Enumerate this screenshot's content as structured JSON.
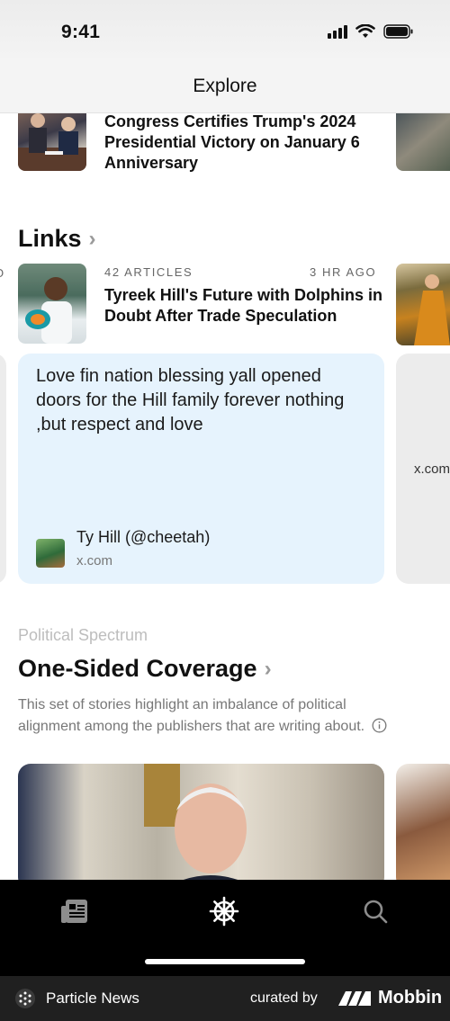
{
  "status_bar": {
    "time": "9:41"
  },
  "nav": {
    "title": "Explore"
  },
  "top_story": {
    "headline": "Congress Certifies Trump's 2024 Presidential Victory on January 6 Anniversary"
  },
  "links_section": {
    "title": "Links",
    "story": {
      "article_count": "42 ARTICLES",
      "time_ago": "3 HR AGO",
      "headline": "Tyreek Hill's Future with Dolphins in Doubt After Trade Speculation"
    },
    "tweet": {
      "text": "Love fin nation blessing yall opened doors for the Hill family forever nothing ,but respect and love",
      "author": "Ty Hill (@cheetah)",
      "source": "x.com"
    },
    "side_card_source": "x.com"
  },
  "political_section": {
    "kicker": "Political Spectrum",
    "title": "One-Sided Coverage",
    "description": "This set of stories highlight an imbalance of political alignment among the publishers that are writing about."
  },
  "tab_bar": {
    "items": [
      {
        "icon": "newspaper-icon",
        "active": false
      },
      {
        "icon": "ship-wheel-icon",
        "active": true
      },
      {
        "icon": "search-icon",
        "active": false
      }
    ]
  },
  "footer": {
    "app_name": "Particle News",
    "curated_label": "curated by",
    "brand": "Mobbin"
  },
  "colors": {
    "tweet_card_bg": "#e6f3fd",
    "tab_bar_bg": "#000000",
    "footer_bg": "#202020",
    "muted_text": "#777777"
  }
}
